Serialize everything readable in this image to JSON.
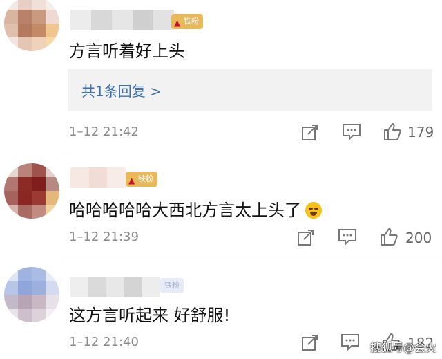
{
  "comments": [
    {
      "badge": "铁粉",
      "text": "方言听着好上头",
      "reply_label": "共1条回复 >",
      "time": "1–12 21:42",
      "likes": "179"
    },
    {
      "badge": "铁粉",
      "text": "哈哈哈哈哈大西北方言太上头了",
      "time": "1–12 21:39",
      "likes": "200"
    },
    {
      "badge": "铁粉",
      "text": "这方言听起来 好舒服!",
      "time": "1–12 21:40",
      "likes": "182"
    }
  ],
  "watermark": "搜狐号@会火",
  "icons": {
    "share": "share-icon",
    "comment": "comment-icon",
    "like": "thumbs-up-icon",
    "emoji": "laughing-crying-emoji-icon"
  },
  "colors": {
    "badge": "#e9b85a",
    "link": "#3c6fb0",
    "muted": "#8a8a8a"
  }
}
